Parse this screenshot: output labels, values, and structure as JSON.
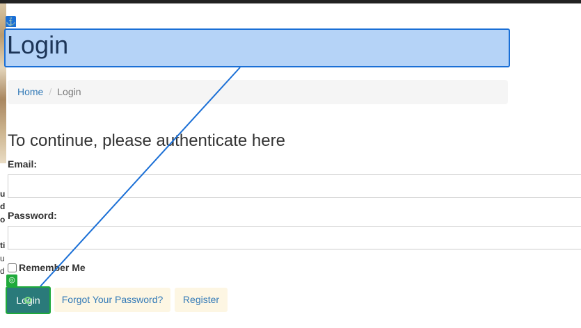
{
  "page": {
    "title": "Login",
    "heading": "To continue, please authenticate here"
  },
  "breadcrumb": {
    "home": "Home",
    "separator": "/",
    "current": "Login"
  },
  "form": {
    "email_label": "Email:",
    "email_value": "",
    "password_label": "Password:",
    "password_value": "",
    "remember_label": "Remember Me",
    "remember_checked": false
  },
  "buttons": {
    "login": "Login",
    "forgot": "Forgot Your Password?",
    "register": "Register"
  },
  "left_strip_fragments": [
    "u",
    "d",
    "o",
    "ti",
    "u",
    "d"
  ],
  "annotation": {
    "anchor_icon": "anchor-icon",
    "target_icon": "target-icon",
    "line_color": "#1a6fd6",
    "highlight_fill": "#b5d3f7",
    "target_color": "#1faa3b"
  }
}
